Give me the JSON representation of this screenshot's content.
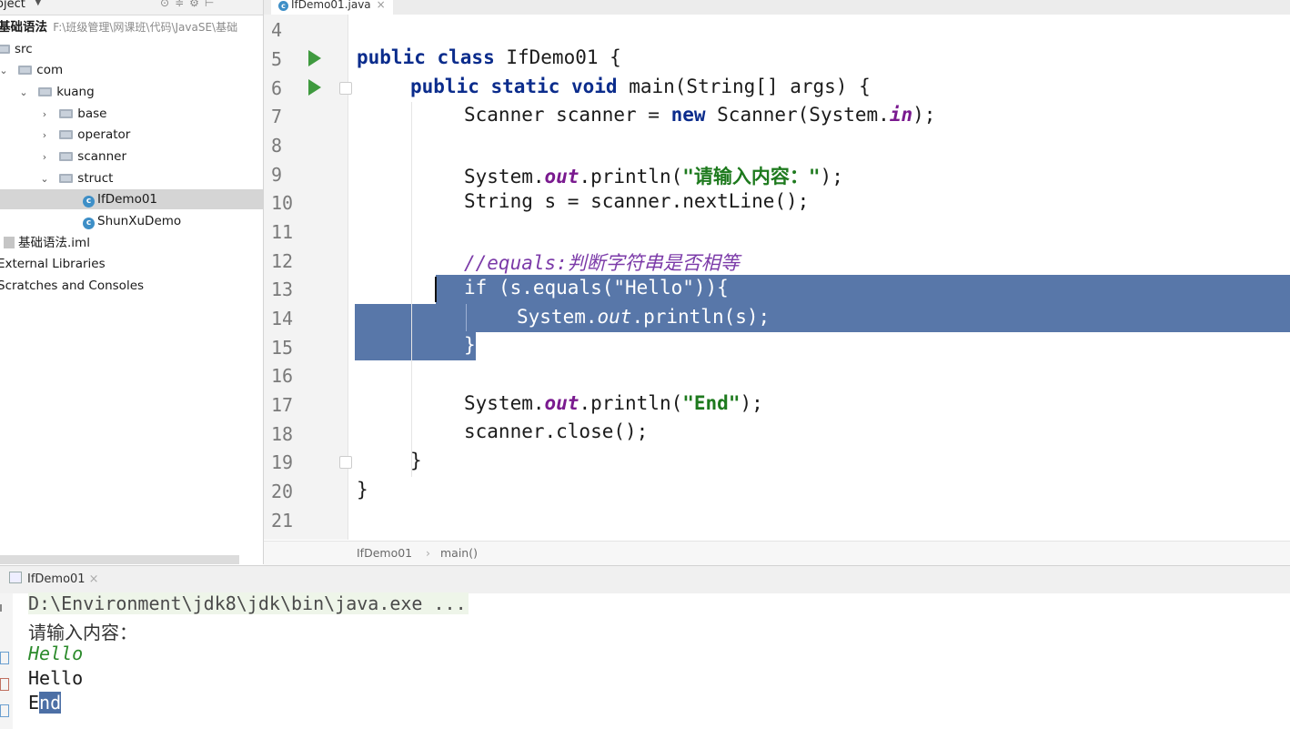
{
  "project": {
    "title": "oject",
    "root_name": "基础语法",
    "root_path": "F:\\班级管理\\网课班\\代码\\JavaSE\\基础",
    "tree": [
      {
        "label": "src",
        "kind": "folder"
      },
      {
        "label": "com",
        "kind": "folder"
      },
      {
        "label": "kuang",
        "kind": "folder"
      },
      {
        "label": "base",
        "kind": "folder"
      },
      {
        "label": "operator",
        "kind": "folder"
      },
      {
        "label": "scanner",
        "kind": "folder"
      },
      {
        "label": "struct",
        "kind": "folder"
      },
      {
        "label": "IfDemo01",
        "kind": "class",
        "selected": true
      },
      {
        "label": "ShunXuDemo",
        "kind": "class"
      },
      {
        "label": "基础语法.iml",
        "kind": "file"
      },
      {
        "label": "External Libraries",
        "kind": "node"
      },
      {
        "label": "Scratches and Consoles",
        "kind": "node"
      }
    ]
  },
  "editor": {
    "tab_label": "IfDemo01.java",
    "line_numbers": [
      "4",
      "5",
      "6",
      "7",
      "8",
      "9",
      "10",
      "11",
      "12",
      "13",
      "14",
      "15",
      "16",
      "17",
      "18",
      "19",
      "20",
      "21"
    ],
    "code": {
      "l5_kw": "public class",
      "l5_rest": " IfDemo01 {",
      "l6_kw": "public static void",
      "l6_rest": " main(String[] args) {",
      "l7_a": "Scanner scanner = ",
      "l7_kw": "new",
      "l7_b": " Scanner(System.",
      "l7_fld": "in",
      "l7_c": ");",
      "l9_a": "System.",
      "l9_fld": "out",
      "l9_b": ".println(",
      "l9_str": "\"请输入内容：\"",
      "l9_c": ");",
      "l10": "String s = scanner.nextLine();",
      "l12_cmt": "//equals:判断字符串是否相等",
      "l13_kw": "if",
      "l13_a": " (s.equals(",
      "l13_str": "\"Hello\"",
      "l13_b": ")){",
      "l14_a": "System.",
      "l14_fld": "out",
      "l14_b": ".println(s);",
      "l15": "}",
      "l17_a": "System.",
      "l17_fld": "out",
      "l17_b": ".println(",
      "l17_str": "\"End\"",
      "l17_c": ");",
      "l18": "scanner.close();",
      "l19": "}",
      "l20": "}"
    },
    "breadcrumb": [
      "IfDemo01",
      "main()"
    ],
    "breadcrumb_sep": "›"
  },
  "run": {
    "tab_label": "IfDemo01",
    "console": {
      "cmd": "D:\\Environment\\jdk8\\jdk\\bin\\java.exe ...",
      "prompt": "请输入内容：",
      "input": "Hello",
      "out1": "Hello",
      "out2_a": "E",
      "out2_b": "nd"
    }
  },
  "colors": {
    "selection": "#5877a9",
    "keyword": "#0b2c8c",
    "string": "#1e7a1e",
    "field": "#7a1a8f",
    "comment": "#7b3aa8",
    "run_gutter": "#3f9a3f"
  }
}
